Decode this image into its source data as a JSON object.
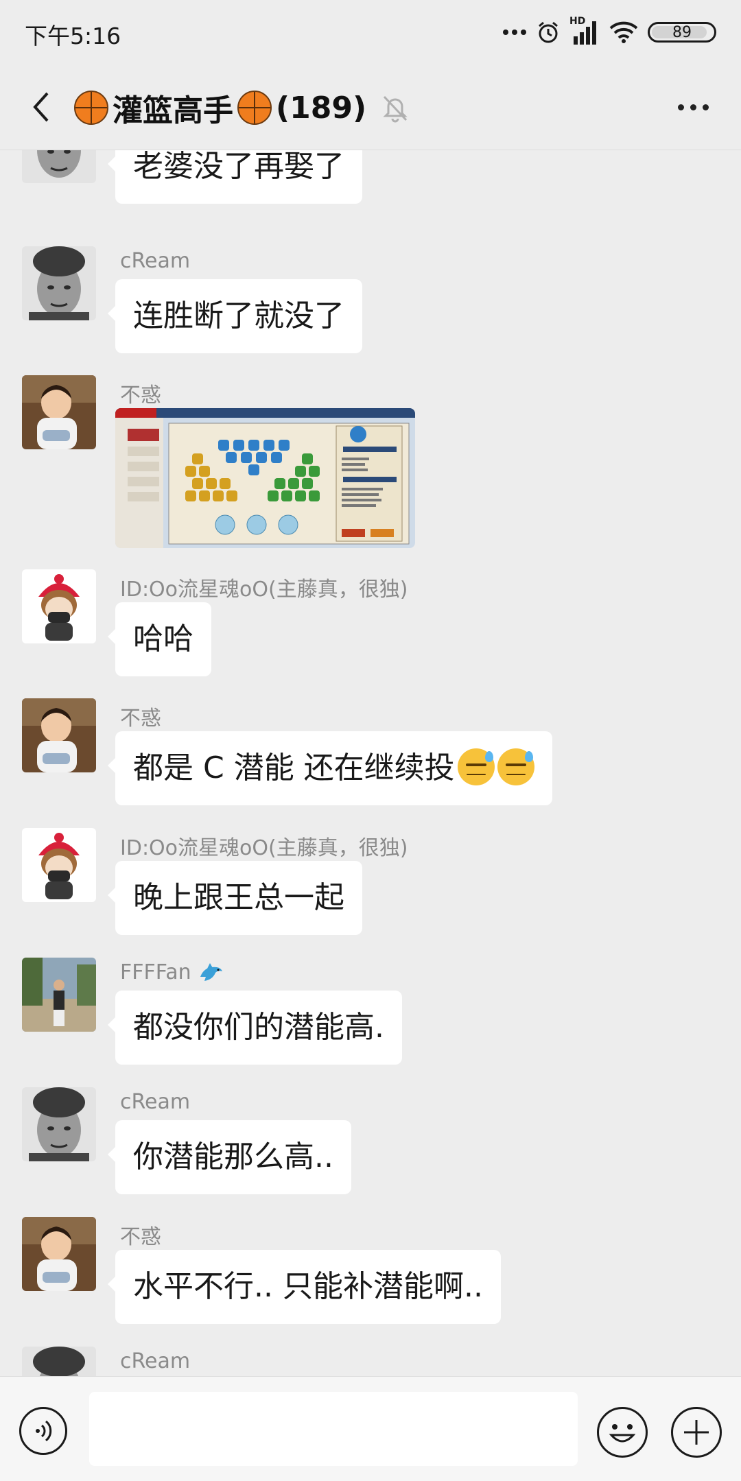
{
  "status_bar": {
    "time": "下午5:16",
    "network_label": "HD",
    "battery": "89"
  },
  "header": {
    "title": "灌篮高手",
    "member_count": "(189)"
  },
  "messages": [
    {
      "sender": "",
      "text": "老婆没了再娶了",
      "avatar": "bw-portrait"
    },
    {
      "sender": "cReam",
      "text": "连胜断了就没了",
      "avatar": "bw-portrait"
    },
    {
      "sender": "不惑",
      "type": "image",
      "avatar": "child-photo"
    },
    {
      "sender": "ID:Oo流星魂oO(主藤真，很独)",
      "text": "哈哈",
      "avatar": "cartoon-redhat"
    },
    {
      "sender": "不惑",
      "text": "都是 C 潜能 还在继续投",
      "emoji": "😓😓",
      "avatar": "child-photo"
    },
    {
      "sender": "ID:Oo流星魂oO(主藤真，很独)",
      "text": "晚上跟王总一起",
      "avatar": "cartoon-redhat"
    },
    {
      "sender": "FFFFan",
      "sender_emoji": "dolphin-icon",
      "text": "都没你们的潜能高.",
      "avatar": "street-photo"
    },
    {
      "sender": "cReam",
      "text": "你潜能那么高..",
      "avatar": "bw-portrait"
    },
    {
      "sender": "不惑",
      "text": "水平不行.. 只能补潜能啊..",
      "avatar": "child-photo"
    },
    {
      "sender": "cReam",
      "avatar": "bw-portrait"
    }
  ],
  "input": {
    "placeholder": ""
  },
  "colors": {
    "background": "#ededed",
    "bubble": "#ffffff",
    "sender_text": "#8a8a8a"
  }
}
